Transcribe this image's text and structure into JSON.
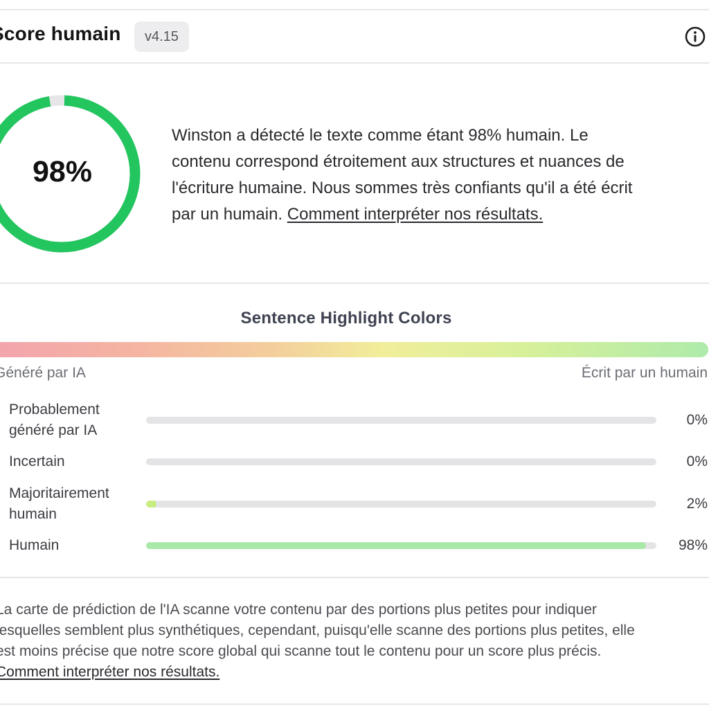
{
  "header": {
    "title": "Score humain",
    "version": "v4.15",
    "info_icon": "info-circle-icon"
  },
  "score": {
    "percent_label": "98%",
    "fraction": 0.98,
    "ring_color": "#22c55e",
    "description_lines": [
      "Winston a détecté le texte comme étant 98% humain. Le",
      "contenu correspond étroitement aux structures et nuances de",
      "l'écriture humaine. Nous sommes très confiants qu'il a été écrit",
      "par un humain."
    ],
    "link_text": "Comment interpréter nos résultats."
  },
  "highlight": {
    "title": "Sentence Highlight Colors",
    "left_label": "Généré par IA",
    "right_label": "Écrit par un humain",
    "stats": [
      {
        "label": "Probablement généré par IA",
        "value_label": "0%",
        "fraction": 0,
        "color": "#f3a3ad"
      },
      {
        "label": "Incertain",
        "value_label": "0%",
        "fraction": 0,
        "color": "#f1ee9a"
      },
      {
        "label": "Majoritairement humain",
        "value_label": "2%",
        "fraction": 0.02,
        "color": "#c7ec7f"
      },
      {
        "label": "Humain",
        "value_label": "98%",
        "fraction": 0.98,
        "color": "#a8e8a8"
      }
    ]
  },
  "footer": {
    "lines": [
      "La carte de prédiction de l'IA scanne votre contenu par des portions plus petites pour indiquer",
      "lesquelles semblent plus synthétiques, cependant, puisqu'elle scanne des portions plus petites, elle",
      "est moins précise que notre score global qui scanne tout le contenu pour un score plus précis."
    ],
    "link_text": "Comment interpréter nos résultats."
  }
}
